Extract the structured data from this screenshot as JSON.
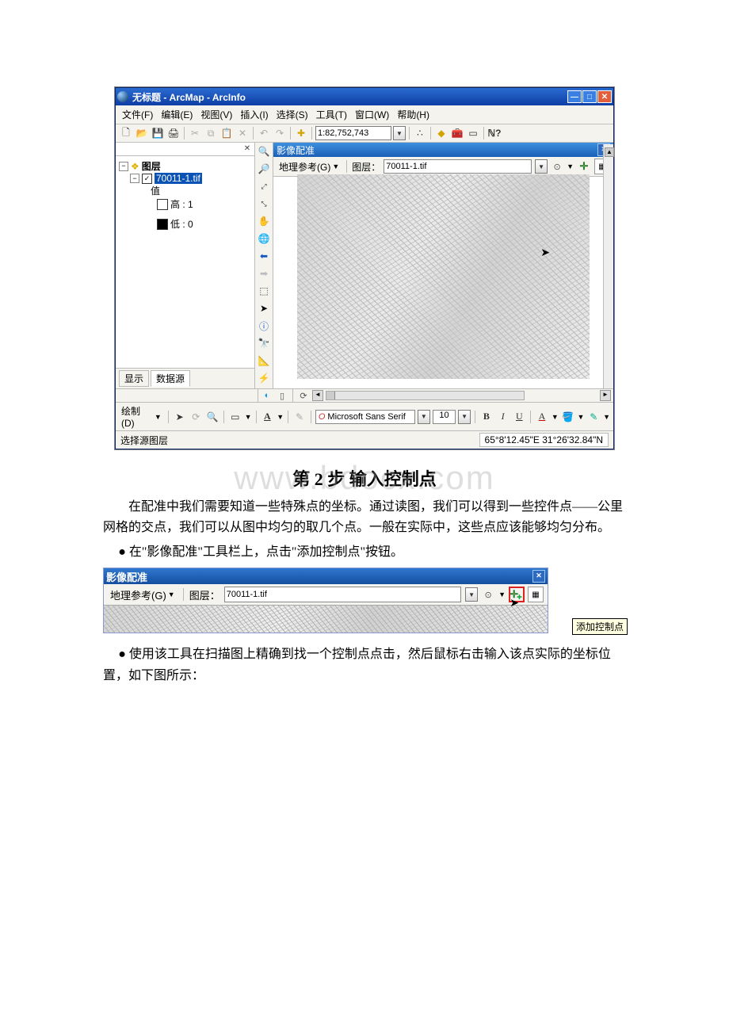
{
  "arcmap": {
    "title": "无标题 - ArcMap - ArcInfo",
    "menu": {
      "file": "文件(F)",
      "edit": "编辑(E)",
      "view": "视图(V)",
      "insert": "插入(I)",
      "select": "选择(S)",
      "tools": "工具(T)",
      "window": "窗口(W)",
      "help": "帮助(H)"
    },
    "toolbar": {
      "scale": "1:82,752,743"
    },
    "toc": {
      "layers_label": "图层",
      "layer_name": "70011-1.tif",
      "value_label": "值",
      "high_label": "高 : 1",
      "low_label": "低 : 0",
      "tab_display": "显示",
      "tab_source": "数据源"
    },
    "georef": {
      "title": "影像配准",
      "menu_label": "地理参考(G)",
      "layer_label": "图层：",
      "layer_value": "70011-1.tif"
    },
    "draw": {
      "label": "绘制(D)",
      "font": "Microsoft Sans Serif",
      "size": "10"
    },
    "status": {
      "message": "选择源图层",
      "coords": "65°8'12.45\"E  31°26'32.84\"N"
    }
  },
  "heading": {
    "step2": "第 2 步 输入控制点"
  },
  "watermark": "www.bdocx.com",
  "para1": "在配准中我们需要知道一些特殊点的坐标。通过读图，我们可以得到一些控件点——公里网格的交点，我们可以从图中均匀的取几个点。一般在实际中，这些点应该能够均匀分布。",
  "para2": "● 在\"影像配准\"工具栏上，点击\"添加控制点\"按钮。",
  "para3": "● 使用该工具在扫描图上精确到找一个控制点点击，然后鼠标右击输入该点实际的坐标位置，如下图所示：",
  "georef_fig": {
    "title": "影像配准",
    "menu_label": "地理参考(G)",
    "layer_label": "图层：",
    "layer_value": "70011-1.tif",
    "tooltip": "添加控制点"
  }
}
